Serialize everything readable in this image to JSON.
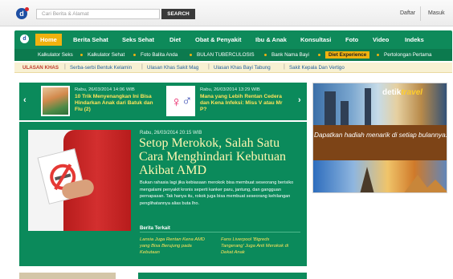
{
  "header": {
    "search_placeholder": "Cari Berita & Alamat",
    "search_button": "SEARCH",
    "daftar": "Daftar",
    "masuk": "Masuk"
  },
  "nav": {
    "items": [
      "Home",
      "Berita Sehat",
      "Seks Sehat",
      "Diet",
      "Obat & Penyakit",
      "Ibu & Anak",
      "Konsultasi",
      "Foto",
      "Video",
      "Indeks"
    ]
  },
  "subnav": {
    "items": [
      "Kalkulator Seks",
      "Kalkulator Sehat",
      "Foto Balita Anda",
      "BULAN TUBERCULOSIS",
      "Bank Nama Bayi",
      "Diet Experience",
      "Pertolongan Pertama"
    ]
  },
  "ulasan": {
    "label": "ULASAN KHAS",
    "items": [
      "Serba-serbi Bentuk Kelamin",
      "Ulasan Khas Sakit Mag",
      "Ulasan Khas Bayi Tabung",
      "Sakit Kepala Dan Vertigo"
    ]
  },
  "carousel": {
    "left_arrow": "‹",
    "right_arrow": "›",
    "items": [
      {
        "date": "Rabu, 26/03/2014 14:06 WIB",
        "title": "10 Trik Menyenangkan Ini Bisa Hindarkan Anak dari Batuk dan Flu (2)"
      },
      {
        "date": "Rabu, 26/03/2014 13:29 WIB",
        "title": "Mana yang Lebih Rentan Cedera dan Kena Infeksi: Miss V atau Mr P?"
      }
    ]
  },
  "feature": {
    "date": "Rabu, 26/03/2014 20:15 WIB",
    "title": "Setop Merokok, Salah Satu Cara Menghindari Kebutuan Akibat AMD",
    "body": "Bukan rahasia lagi jika kebiasaan merokok bisa membuat seseorang berisiko mengalami penyakit kronis seperti kanker paru, jantung, dan gangguan pernapasan. Tak hanya itu, rokok juga bisa membuat seseorang kehilangan penglihatannya alias buta lho.",
    "related_label": "Berita Terkait",
    "related": [
      "Lansia Juga Rentan Kena AMD yang Bisa Berujung pada Kebutaan",
      "Fans Liverpool 'Bigreds Tangerang' Juga Anti Merokok di Dekat Anak"
    ]
  },
  "ad": {
    "logo_main": "detik",
    "logo_accent": "travel",
    "text": "Dapatkan hadiah menarik di setiap bulannya."
  },
  "icons": {
    "gender_male": "♂",
    "gender_female": "♀"
  },
  "colors": {
    "nav_green": "#0e8a5a",
    "accent_yellow": "#f1b20f",
    "headline_yellow": "#ffe35a"
  }
}
